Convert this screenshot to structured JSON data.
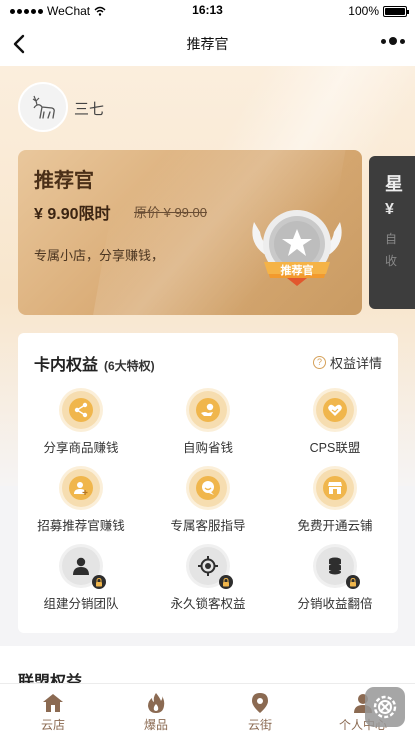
{
  "status_bar": {
    "carrier": "WeChat",
    "time": "16:13",
    "battery": "100%",
    "battery_level": 1.0
  },
  "nav": {
    "title": "推荐官",
    "back_icon": "chevron-left-icon",
    "more_icon": "more-dots-icon"
  },
  "user": {
    "name": "三七",
    "avatar_icon": "deer-icon"
  },
  "vip_card": {
    "title": "推荐官",
    "price": "¥ 9.90限时",
    "original_price": "原价 ¥ 99.00",
    "description": "专属小店，分享赚钱，",
    "badge_label": "推荐官"
  },
  "next_card": {
    "title": "星",
    "price": "¥",
    "line1": "自",
    "line2": "收"
  },
  "benefits": {
    "title": "卡内权益",
    "subtitle": "(6大特权)",
    "detail_label": "权益详情",
    "items": [
      {
        "label": "分享商品赚钱",
        "icon": "share-icon",
        "locked": false
      },
      {
        "label": "自购省钱",
        "icon": "save-money-icon",
        "locked": false
      },
      {
        "label": "CPS联盟",
        "icon": "handshake-icon",
        "locked": false
      },
      {
        "label": "招募推荐官赚钱",
        "icon": "add-user-icon",
        "locked": false
      },
      {
        "label": "专属客服指导",
        "icon": "customer-service-icon",
        "locked": false
      },
      {
        "label": "免费开通云铺",
        "icon": "store-icon",
        "locked": false
      },
      {
        "label": "组建分销团队",
        "icon": "team-icon",
        "locked": true
      },
      {
        "label": "永久锁客权益",
        "icon": "target-lock-icon",
        "locked": true
      },
      {
        "label": "分销收益翻倍",
        "icon": "coins-stack-icon",
        "locked": true
      }
    ]
  },
  "alliance": {
    "title": "联盟权益"
  },
  "tab_bar": {
    "tabs": [
      {
        "label": "云店",
        "icon": "home-icon"
      },
      {
        "label": "爆品",
        "icon": "flame-icon"
      },
      {
        "label": "云街",
        "icon": "location-pin-icon"
      },
      {
        "label": "个人中心",
        "icon": "person-icon"
      }
    ]
  },
  "floating_button": {
    "icon": "settings-close-icon"
  },
  "colors": {
    "accent_gold": "#f0b64c",
    "card_gold": "#d9ab75",
    "tab_text": "#8b6a52"
  }
}
